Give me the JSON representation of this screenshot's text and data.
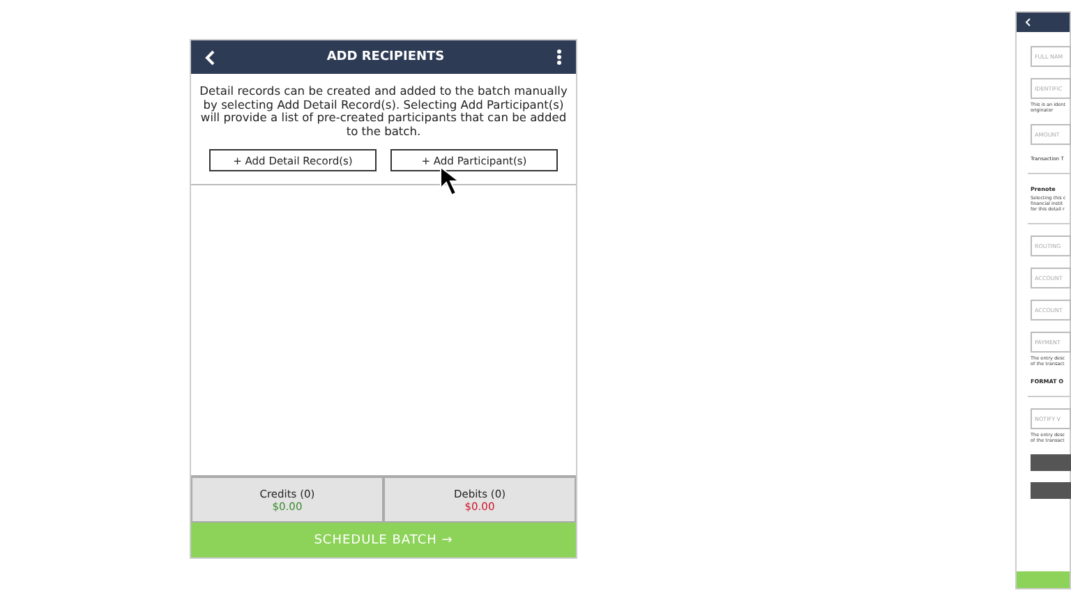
{
  "main_screen": {
    "title": "ADD RECIPIENTS",
    "intro": "Detail records can be created and added to the batch manually by selecting Add Detail Record(s). Selecting Add Participant(s) will provide a list of pre-created participants that can be added to the batch.",
    "buttons": [
      "+ Add Detail Record(s)",
      "+ Add Participant(s)"
    ],
    "totals": [
      {
        "label": "Credits (0)",
        "amount": "$0.00",
        "kind": "credit"
      },
      {
        "label": "Debits (0)",
        "amount": "$0.00",
        "kind": "debit"
      }
    ],
    "action": "SCHEDULE BATCH →"
  },
  "side_screen": {
    "items": [
      {
        "kind": "field",
        "placeholder": "FULL NAM"
      },
      {
        "kind": "field",
        "placeholder": "IDENTIFIC"
      },
      {
        "kind": "note",
        "lines": [
          "This is an ident",
          "originator"
        ]
      },
      {
        "kind": "field",
        "placeholder": "AMOUNT"
      },
      {
        "kind": "label",
        "text": "Transaction T"
      },
      {
        "kind": "divider"
      },
      {
        "kind": "heading",
        "text": "Prenote"
      },
      {
        "kind": "note",
        "lines": [
          "Selecting this c",
          "financial instit",
          "for this detail r"
        ]
      },
      {
        "kind": "divider"
      },
      {
        "kind": "field",
        "placeholder": "ROUTING"
      },
      {
        "kind": "field",
        "placeholder": "ACCOUNT"
      },
      {
        "kind": "field",
        "placeholder": "ACCOUNT"
      },
      {
        "kind": "field",
        "placeholder": "PAYMENT"
      },
      {
        "kind": "note",
        "lines": [
          "The entry desc",
          "of the transact"
        ]
      },
      {
        "kind": "heading",
        "text": "FORMAT O"
      },
      {
        "kind": "divider"
      },
      {
        "kind": "field",
        "placeholder": "NOTIFY V"
      },
      {
        "kind": "note",
        "lines": [
          "The entry desc",
          "of the transact"
        ]
      },
      {
        "kind": "button"
      },
      {
        "kind": "button"
      }
    ]
  }
}
